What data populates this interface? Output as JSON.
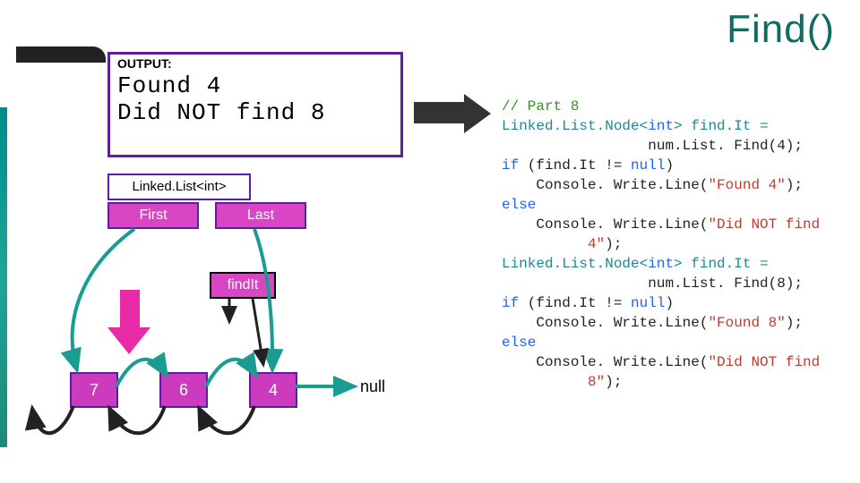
{
  "title": "Find()",
  "output": {
    "label": "OUTPUT:",
    "line1": "Found 4",
    "line2": "Did NOT find 8"
  },
  "diagram": {
    "class_label": "Linked.List<int>",
    "first_label": "First",
    "last_label": "Last",
    "findit_label": "findIt",
    "nodes": [
      "7",
      "6",
      "4"
    ],
    "null_label": "null"
  },
  "code": {
    "comment": "// Part 8",
    "l1a": "Linked.List.Node<",
    "l1b": "int",
    "l1c": "> find.It =",
    "l1d": "                 num.List. Find(4);",
    "l2a": "if",
    "l2b": " (find.It != ",
    "l2c": "null",
    "l2d": ")",
    "l3a": "    Console. Write.Line(",
    "l3b": "\"Found 4\"",
    "l3c": ");",
    "l4": "else",
    "l5a": "    Console. Write.Line(",
    "l5b": "\"Did NOT find\n          4\"",
    "l5c": ");",
    "l6a": "Linked.List.Node<",
    "l6b": "int",
    "l6c": "> find.It =",
    "l6d": "                 num.List. Find(8);",
    "l7a": "if",
    "l7b": " (find.It != ",
    "l7c": "null",
    "l7d": ")",
    "l8a": "    Console. Write.Line(",
    "l8b": "\"Found 8\"",
    "l8c": ");",
    "l9": "else",
    "l10a": "    Console. Write.Line(",
    "l10b": "\"Did NOT find\n          8\"",
    "l10c": ");"
  }
}
